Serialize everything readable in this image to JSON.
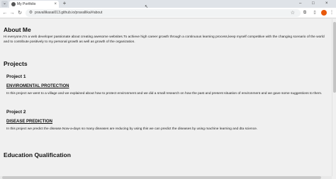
{
  "browser": {
    "tab_dropdown_icon": "chevron-down-icon",
    "tab_title": "My Portfolio",
    "tab_close": "×",
    "new_tab": "+",
    "url": "pravallikasai013.github.io/pravallika/#about",
    "window_controls": [
      "–",
      "□",
      "×"
    ]
  },
  "page": {
    "about_title": "About Me",
    "about_text": "Hi everyone,I'm a web developer passionate about creating awesome websites.To achieve high career growth through a continuous learning process,keep myself competitive with the changing scenario of the world and to contribute positively to my personal growth as well as growth of the organization.",
    "projects_title": "Projects",
    "projects": [
      {
        "label": "Project 1",
        "name": "ENVIROMENTAL PROTECTION",
        "description": "In this project we went to a village and we explained about how to protect environment and we did a small research on how the past and present situation of environment and we gave some suggestions to them."
      },
      {
        "label": "Project 2",
        "name": "DISEASE PREDICTION",
        "description": "In this project we predict the disease.Now-a-days so many diseases are reducing by using this we can predict the diseases by using machine learning and dta science."
      }
    ],
    "education_title": "Education Qualification"
  }
}
